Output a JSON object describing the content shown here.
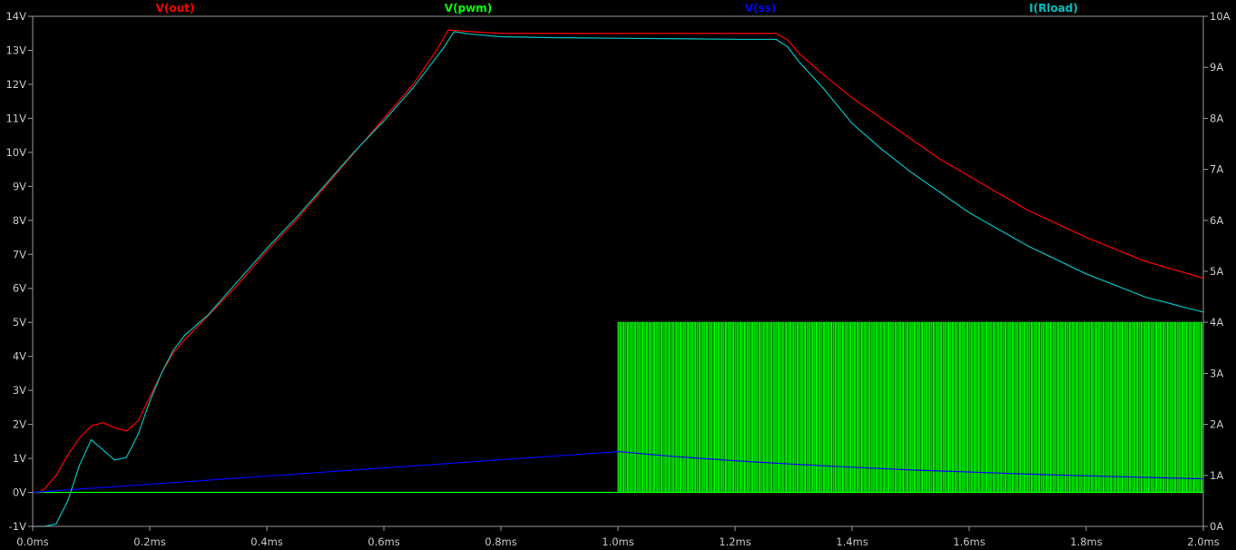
{
  "chart_data": {
    "type": "line",
    "title": "",
    "background": "#000000",
    "grid": false,
    "x_axis": {
      "range": [
        0.0,
        2.0
      ],
      "ticks": [
        0.0,
        0.2,
        0.4,
        0.6,
        0.8,
        1.0,
        1.2,
        1.4,
        1.6,
        1.8,
        2.0
      ],
      "tick_labels": [
        "0.0ms",
        "0.2ms",
        "0.4ms",
        "0.6ms",
        "0.8ms",
        "1.0ms",
        "1.2ms",
        "1.4ms",
        "1.6ms",
        "1.8ms",
        "2.0ms"
      ]
    },
    "y_left": {
      "range": [
        -1,
        14
      ],
      "ticks": [
        -1,
        0,
        1,
        2,
        3,
        4,
        5,
        6,
        7,
        8,
        9,
        10,
        11,
        12,
        13,
        14
      ],
      "tick_labels": [
        "-1V",
        "0V",
        "1V",
        "2V",
        "3V",
        "4V",
        "5V",
        "6V",
        "7V",
        "8V",
        "9V",
        "10V",
        "11V",
        "12V",
        "13V",
        "14V"
      ]
    },
    "y_right": {
      "range": [
        0,
        10
      ],
      "ticks": [
        0,
        1,
        2,
        3,
        4,
        5,
        6,
        7,
        8,
        9,
        10
      ],
      "tick_labels": [
        "0A",
        "1A",
        "2A",
        "3A",
        "4A",
        "5A",
        "6A",
        "7A",
        "8A",
        "9A",
        "10A"
      ]
    },
    "legend": [
      "V(out)",
      "V(pwm)",
      "V(ss)",
      "I(Rload)"
    ],
    "series": [
      {
        "name": "V(out)",
        "color": "#ff0000",
        "axis": "left",
        "x": [
          0.0,
          0.01,
          0.02,
          0.04,
          0.06,
          0.08,
          0.1,
          0.12,
          0.14,
          0.16,
          0.18,
          0.2,
          0.22,
          0.24,
          0.26,
          0.3,
          0.35,
          0.4,
          0.45,
          0.5,
          0.55,
          0.6,
          0.65,
          0.69,
          0.71,
          0.75,
          0.8,
          0.9,
          1.0,
          1.1,
          1.2,
          1.27,
          1.29,
          1.31,
          1.35,
          1.4,
          1.45,
          1.5,
          1.55,
          1.6,
          1.7,
          1.8,
          1.9,
          2.0
        ],
        "y": [
          0.0,
          0.0,
          0.1,
          0.5,
          1.1,
          1.6,
          1.95,
          2.05,
          1.9,
          1.8,
          2.1,
          2.8,
          3.5,
          4.1,
          4.5,
          5.2,
          6.1,
          7.1,
          8.0,
          9.0,
          10.0,
          11.0,
          12.0,
          13.0,
          13.6,
          13.55,
          13.5,
          13.5,
          13.5,
          13.5,
          13.5,
          13.5,
          13.3,
          12.9,
          12.3,
          11.6,
          11.0,
          10.4,
          9.8,
          9.3,
          8.3,
          7.5,
          6.8,
          6.3
        ]
      },
      {
        "name": "V(pwm)",
        "color": "#00ff00",
        "axis": "left",
        "x": [
          0.0,
          1.0,
          2.0
        ],
        "y": [
          0.0,
          0.0,
          0.0
        ],
        "pulse_train": {
          "start": 1.0,
          "end": 2.0,
          "count": 245,
          "high": 5.0,
          "low": 0.0
        }
      },
      {
        "name": "V(ss)",
        "color": "#0000ff",
        "axis": "left",
        "x": [
          0.0,
          0.25,
          0.5,
          0.75,
          1.0,
          1.1,
          1.2,
          1.3,
          1.4,
          1.5,
          1.6,
          1.7,
          1.8,
          1.9,
          2.0
        ],
        "y": [
          0.0,
          0.3,
          0.6,
          0.9,
          1.2,
          1.05,
          0.93,
          0.83,
          0.74,
          0.66,
          0.6,
          0.54,
          0.49,
          0.44,
          0.4
        ]
      },
      {
        "name": "I(Rload)",
        "color": "#00c0c0",
        "axis": "right",
        "x": [
          0.0,
          0.02,
          0.04,
          0.06,
          0.08,
          0.1,
          0.12,
          0.14,
          0.16,
          0.18,
          0.2,
          0.22,
          0.24,
          0.26,
          0.3,
          0.35,
          0.4,
          0.45,
          0.5,
          0.55,
          0.6,
          0.65,
          0.7,
          0.72,
          0.75,
          0.8,
          0.9,
          1.0,
          1.1,
          1.2,
          1.27,
          1.29,
          1.31,
          1.35,
          1.4,
          1.45,
          1.5,
          1.55,
          1.6,
          1.7,
          1.8,
          1.9,
          2.0
        ],
        "y": [
          0.0,
          0.0,
          0.05,
          0.5,
          1.2,
          1.7,
          1.5,
          1.3,
          1.35,
          1.8,
          2.45,
          3.0,
          3.45,
          3.75,
          4.15,
          4.8,
          5.45,
          6.05,
          6.7,
          7.35,
          7.95,
          8.6,
          9.35,
          9.7,
          9.65,
          9.6,
          9.58,
          9.57,
          9.56,
          9.55,
          9.55,
          9.4,
          9.1,
          8.6,
          7.9,
          7.4,
          6.95,
          6.55,
          6.15,
          5.5,
          4.95,
          4.5,
          4.2
        ]
      }
    ]
  }
}
